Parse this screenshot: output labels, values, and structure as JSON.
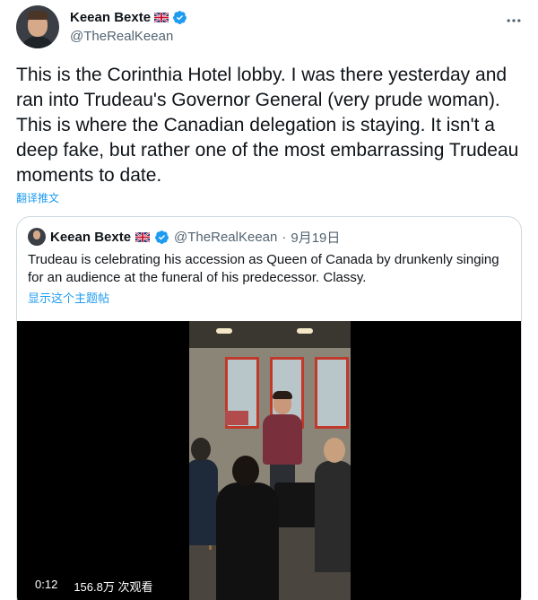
{
  "tweet": {
    "author": {
      "display_name": "Keean Bexte",
      "handle": "@TheRealKeean",
      "flag_icon": "uk-flag-icon",
      "verified_icon": "verified-badge-icon"
    },
    "text": "This is the Corinthia Hotel lobby. I was there yesterday and ran into Trudeau's Governor General (very prude woman). This is where the Canadian delegation is staying. It isn't a deep fake, but rather one of the most embarrassing Trudeau moments to date.",
    "translate_label": "翻译推文",
    "more_icon": "more-options-icon"
  },
  "quote": {
    "author": {
      "display_name": "Keean Bexte",
      "handle": "@TheRealKeean"
    },
    "separator": "·",
    "date": "9月19日",
    "text": "Trudeau is celebrating his accession as Queen of Canada by drunkenly singing for an audience at the funeral of his predecessor. Classy.",
    "show_thread_label": "显示这个主题帖",
    "video": {
      "duration": "0:12",
      "views": "156.8万 次观看"
    }
  },
  "colors": {
    "text": "#0f1419",
    "secondary": "#536471",
    "link": "#1d9bf0",
    "border": "#cfd9de"
  }
}
